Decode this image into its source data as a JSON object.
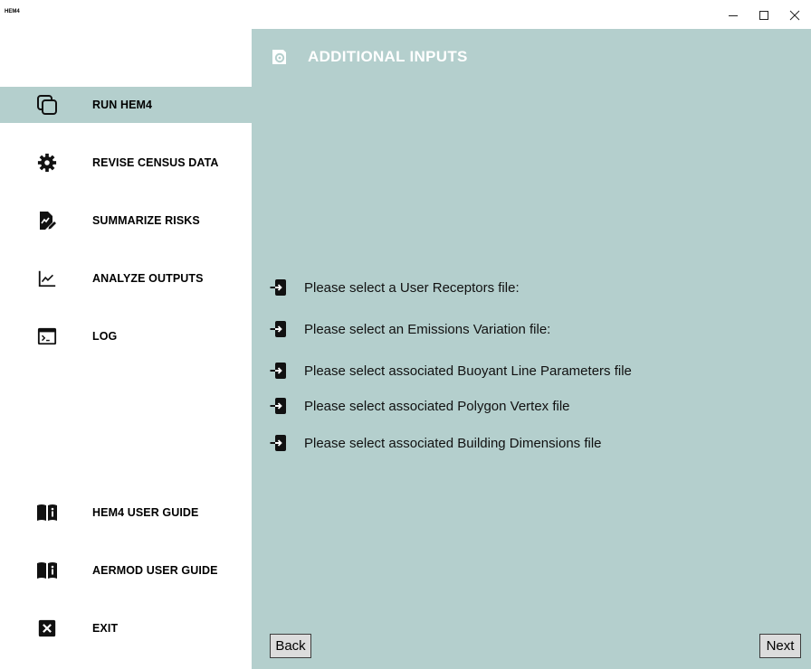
{
  "window": {
    "title": "HEM4",
    "controls": {
      "minimize_icon": "minimize-icon",
      "maximize_icon": "maximize-icon",
      "close_icon": "close-icon"
    }
  },
  "sidebar": {
    "items": [
      {
        "label": "RUN HEM4",
        "icon": "run-copy-icon",
        "active": true
      },
      {
        "label": "REVISE CENSUS DATA",
        "icon": "gear-icon",
        "active": false
      },
      {
        "label": "SUMMARIZE RISKS",
        "icon": "document-chart-icon",
        "active": false
      },
      {
        "label": "ANALYZE OUTPUTS",
        "icon": "line-chart-icon",
        "active": false
      },
      {
        "label": "LOG",
        "icon": "terminal-icon",
        "active": false
      },
      {
        "label": "HEM4 USER GUIDE",
        "icon": "book-info-icon",
        "active": false
      },
      {
        "label": "AERMOD USER GUIDE",
        "icon": "book-info-icon",
        "active": false
      },
      {
        "label": "EXIT",
        "icon": "close-box-icon",
        "active": false
      }
    ]
  },
  "main": {
    "title": "ADDITIONAL INPUTS",
    "title_icon": "app-logo-icon",
    "file_prompts": [
      {
        "label": "Please select a User Receptors file:",
        "icon": "file-import-icon"
      },
      {
        "label": "Please select an Emissions Variation file:",
        "icon": "file-import-icon"
      },
      {
        "label": "Please select associated Buoyant Line Parameters file",
        "icon": "file-import-icon"
      },
      {
        "label": "Please select associated Polygon Vertex file",
        "icon": "file-import-icon"
      },
      {
        "label": "Please select associated Building Dimensions file",
        "icon": "file-import-icon"
      }
    ],
    "back_label": "Back",
    "next_label": "Next"
  },
  "colors": {
    "accent_panel": "#b4cfcd",
    "header_text": "#ffffff",
    "button_bg": "#dcdcdc"
  }
}
